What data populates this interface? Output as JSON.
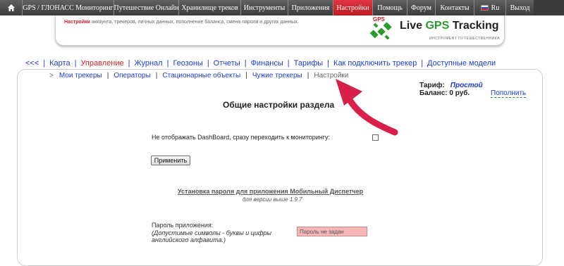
{
  "topnav": {
    "items": [
      {
        "label": "GPS / ГЛОНАСС Мониторинг",
        "width": 130
      },
      {
        "label": "Путешествие Онлайн",
        "width": 92
      },
      {
        "label": "Хранилище треков",
        "width": 88
      },
      {
        "label": "Инструменты",
        "width": 67
      },
      {
        "label": "Приложения",
        "width": 64
      },
      {
        "label": "Настройки",
        "width": 56,
        "active": true
      },
      {
        "label": "Помощь",
        "width": 49
      },
      {
        "label": "Форум",
        "width": 40
      },
      {
        "label": "Контакты",
        "width": 55
      },
      {
        "label": "Ru",
        "width": 45,
        "flag": true
      },
      {
        "label": "Выход",
        "width": 40
      }
    ]
  },
  "banner": {
    "desc_highlight": "Настройки",
    "desc_rest": " аккаунта, трекеров, личных данных, пополнение баланса, смена пароля и других данных.",
    "logo_badge": "GPS",
    "logo_live": "Live ",
    "logo_gps": "GPS",
    "logo_tracking": " Tracking",
    "logo_sub": "ИНСТРУМЕНТ ПУТЕШЕСТВЕННИКА"
  },
  "mainmenu": {
    "back": "<<<",
    "items": [
      {
        "label": "Карта"
      },
      {
        "label": "Управление",
        "active": true
      },
      {
        "label": "Журнал"
      },
      {
        "label": "Геозоны"
      },
      {
        "label": "Отчеты"
      },
      {
        "label": "Финансы"
      },
      {
        "label": "Тарифы"
      },
      {
        "label": "Как подключить трекер"
      },
      {
        "label": "Доступные модели"
      }
    ]
  },
  "submenu": {
    "arrow": ">",
    "items": [
      {
        "label": "Мои трекеры"
      },
      {
        "label": "Операторы"
      },
      {
        "label": "Стационарные объекты"
      },
      {
        "label": "Чужие трекеры"
      },
      {
        "label": "Настройки",
        "current": true
      }
    ]
  },
  "account": {
    "tariff_label": "Тариф:",
    "tariff_value": "Простой",
    "balance_label": "Баланс: 0 руб.",
    "topup": "Пополнить"
  },
  "settings": {
    "title": "Общие настройки раздела",
    "dashboard_label": "Не отображать DashBoard, сразу переходить к мониторингу:",
    "apply": "Применить"
  },
  "mobile_password": {
    "title": "Установка пароля для приложения Мобильный Диспетчер",
    "subtitle": "для версии выше 1.9.7",
    "label": "Пароль приложения:",
    "hint": "(Допустимые символы - буквы и цифры английского алфавита.)",
    "placeholder": "Пароль не задан"
  },
  "colors": {
    "active_tab": "#bb1c26",
    "link": "#1a3bd6",
    "accent_red": "#d0202c",
    "arrow": "#d81f4a",
    "password_field": "#f7b7b7"
  }
}
